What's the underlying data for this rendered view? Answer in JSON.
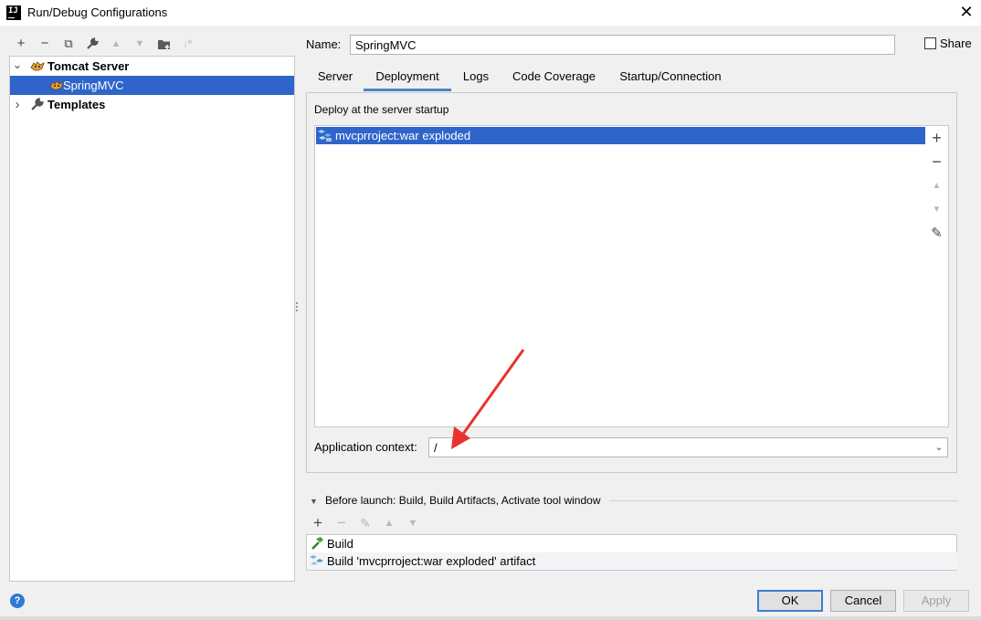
{
  "window": {
    "app_icon_text": "IJ",
    "title": "Run/Debug Configurations",
    "close_glyph": "✕"
  },
  "left_toolbar": {
    "icons": [
      "add-icon",
      "remove-icon",
      "copy-icon",
      "wrench-icon",
      "move-up-icon",
      "move-down-icon",
      "new-folder-icon",
      "sort-icon"
    ],
    "add_glyph": "+",
    "remove_glyph": "−",
    "copy_glyph": "⧉",
    "wrench_glyph": "🔧",
    "up_glyph": "▲",
    "down_glyph": "▼",
    "folder_glyph": "▆",
    "sort_glyph": "↓ª"
  },
  "tree": {
    "items": [
      {
        "label": "Tomcat Server",
        "expanded": true
      },
      {
        "label": "SpringMVC",
        "selected": true
      },
      {
        "label": "Templates",
        "expanded": false
      }
    ],
    "expanded_glyph": "⌄",
    "collapsed_glyph": "›"
  },
  "name_field": {
    "label": "Name:",
    "value": "SpringMVC"
  },
  "share": {
    "label": "Share",
    "checked": false
  },
  "tabs": [
    {
      "label": "Server",
      "active": false
    },
    {
      "label": "Deployment",
      "active": true
    },
    {
      "label": "Logs",
      "active": false
    },
    {
      "label": "Code Coverage",
      "active": false
    },
    {
      "label": "Startup/Connection",
      "active": false
    }
  ],
  "deployment": {
    "caption": "Deploy at the server startup",
    "items": [
      {
        "label": "mvcprroject:war exploded",
        "selected": true
      }
    ],
    "side_toolbar": {
      "add": "+",
      "remove": "−",
      "up": "▲",
      "down": "▼",
      "edit": "✎"
    }
  },
  "application_context": {
    "label": "Application context:",
    "value": "/",
    "caret": "⌄"
  },
  "before_launch": {
    "toggle_glyph": "▼",
    "title": "Before launch: Build, Build Artifacts, Activate tool window",
    "toolbar": {
      "add": "+",
      "remove": "−",
      "edit": "✎",
      "up": "▲",
      "down": "▼"
    },
    "items": [
      {
        "label": "Build",
        "icon": "hammer-icon"
      },
      {
        "label": "Build 'mvcprroject:war exploded' artifact",
        "icon": "artifact-icon"
      }
    ]
  },
  "buttons": {
    "ok": "OK",
    "cancel": "Cancel",
    "apply": "Apply",
    "help": "?"
  },
  "colors": {
    "selection": "#2f65ca",
    "accent": "#4a86c7",
    "annotation_arrow": "#e8332c"
  }
}
